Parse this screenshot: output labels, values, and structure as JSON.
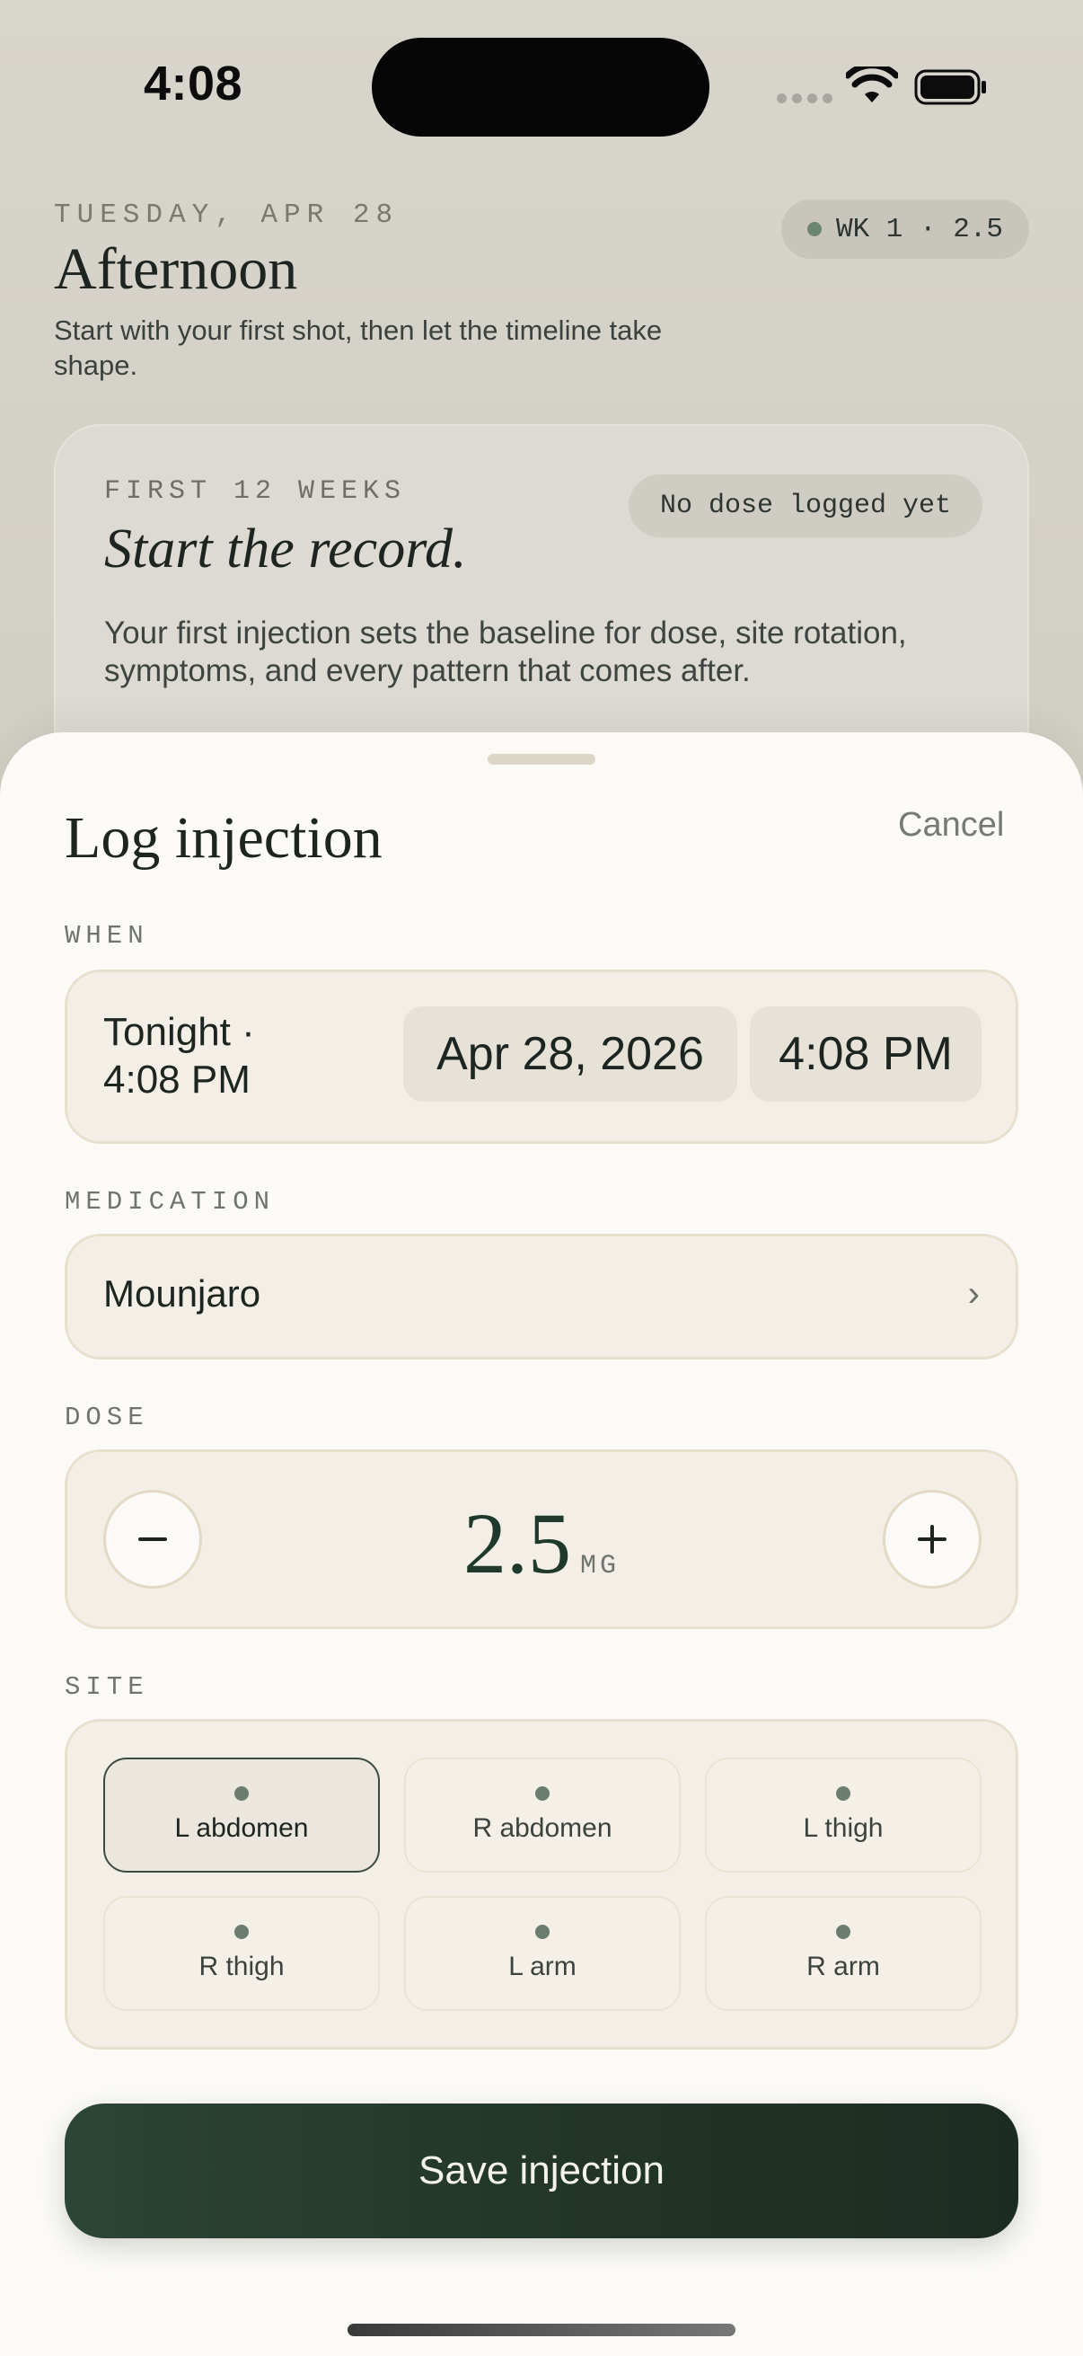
{
  "status_bar": {
    "time": "4:08"
  },
  "background": {
    "date": "TUESDAY, APR 28",
    "greeting": "Afternoon",
    "subtitle": "Start with your first shot, then let the timeline take shape.",
    "week_pill": "WK 1 · 2.5",
    "card": {
      "eyebrow": "FIRST 12 WEEKS",
      "status": "No dose logged yet",
      "title": "Start the record.",
      "body": "Your first injection sets the baseline for dose, site rotation, symptoms, and every pattern that comes after."
    }
  },
  "sheet": {
    "title": "Log injection",
    "cancel_label": "Cancel",
    "when": {
      "label": "WHEN",
      "summary_line1": "Tonight ·",
      "summary_line2": "4:08 PM",
      "date": "Apr 28, 2026",
      "time": "4:08 PM"
    },
    "medication": {
      "label": "MEDICATION",
      "value": "Mounjaro",
      "chevron": "›"
    },
    "dose": {
      "label": "DOSE",
      "value": "2.5",
      "unit": "MG",
      "minus": "−",
      "plus": "+"
    },
    "site": {
      "label": "SITE",
      "selected": "L abdomen",
      "options": [
        "L abdomen",
        "R abdomen",
        "L thigh",
        "R thigh",
        "L arm",
        "R arm"
      ]
    },
    "save_label": "Save injection"
  },
  "colors": {
    "accent_dark_green": "#223528",
    "sheet_background": "#fbfaf6",
    "panel_background": "#f3efe6",
    "dot_green": "#6b7d70"
  }
}
